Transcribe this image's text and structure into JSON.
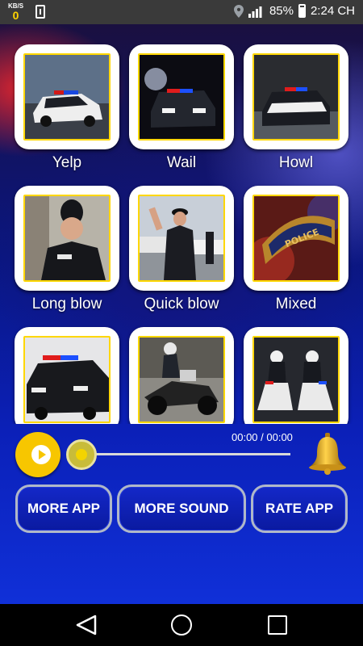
{
  "status_bar": {
    "speed_unit": "KB/S",
    "speed_value": "0",
    "battery_text": "85%",
    "time": "2:24 CH"
  },
  "tiles": [
    {
      "label": "Yelp"
    },
    {
      "label": "Wail"
    },
    {
      "label": "Howl"
    },
    {
      "label": "Long blow"
    },
    {
      "label": "Quick blow"
    },
    {
      "label": "Mixed"
    },
    {
      "label": ""
    },
    {
      "label": ""
    },
    {
      "label": ""
    }
  ],
  "player": {
    "time_text": "00:00 / 00:00",
    "progress": 0
  },
  "buttons": {
    "more_app": "MORE APP",
    "more_sound": "MORE SOUND",
    "rate_app": "RATE APP"
  },
  "colors": {
    "accent": "#f7c600",
    "button_bg": "#1428c8",
    "tile_border": "#ffd700"
  }
}
